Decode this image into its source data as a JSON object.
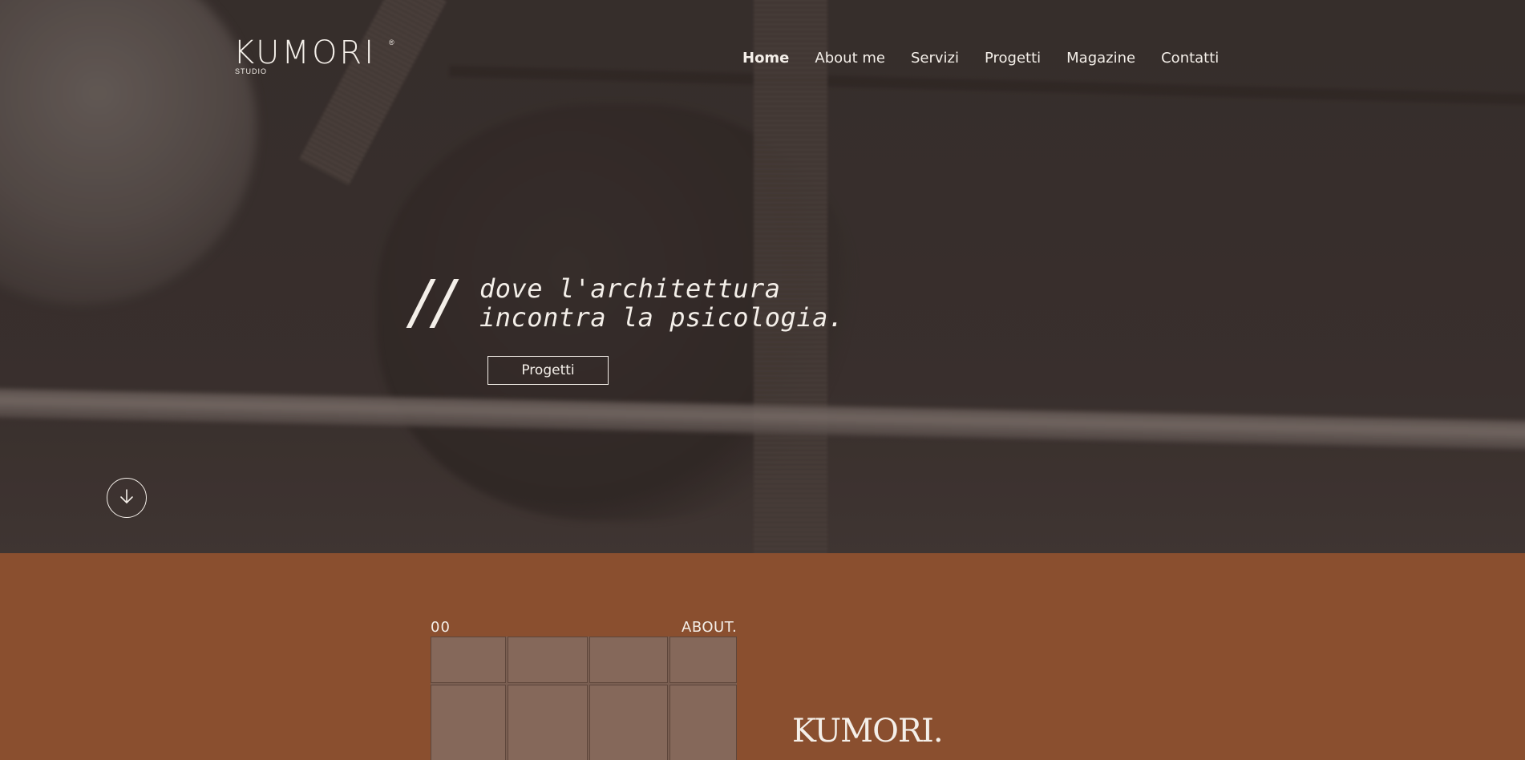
{
  "brand": {
    "logo_main": "KUMORI",
    "logo_reg": "®",
    "logo_sub": "STUDIO"
  },
  "nav": {
    "items": [
      {
        "label": "Home",
        "active": true
      },
      {
        "label": "About me",
        "active": false
      },
      {
        "label": "Servizi",
        "active": false
      },
      {
        "label": "Progetti",
        "active": false
      },
      {
        "label": "Magazine",
        "active": false
      },
      {
        "label": "Contatti",
        "active": false
      }
    ]
  },
  "hero": {
    "slashes": "//",
    "tagline_line1": "dove l'architettura",
    "tagline_line2": "incontra la psicologia.",
    "cta_label": "Progetti",
    "scroll_icon": "arrow-down-icon"
  },
  "about": {
    "number": "00",
    "label": "ABOUT.",
    "brand": "KUMORI."
  },
  "colors": {
    "text_light": "#f4efe9",
    "about_bg": "#8a4f2f",
    "hero_dark": "#3a322f"
  }
}
